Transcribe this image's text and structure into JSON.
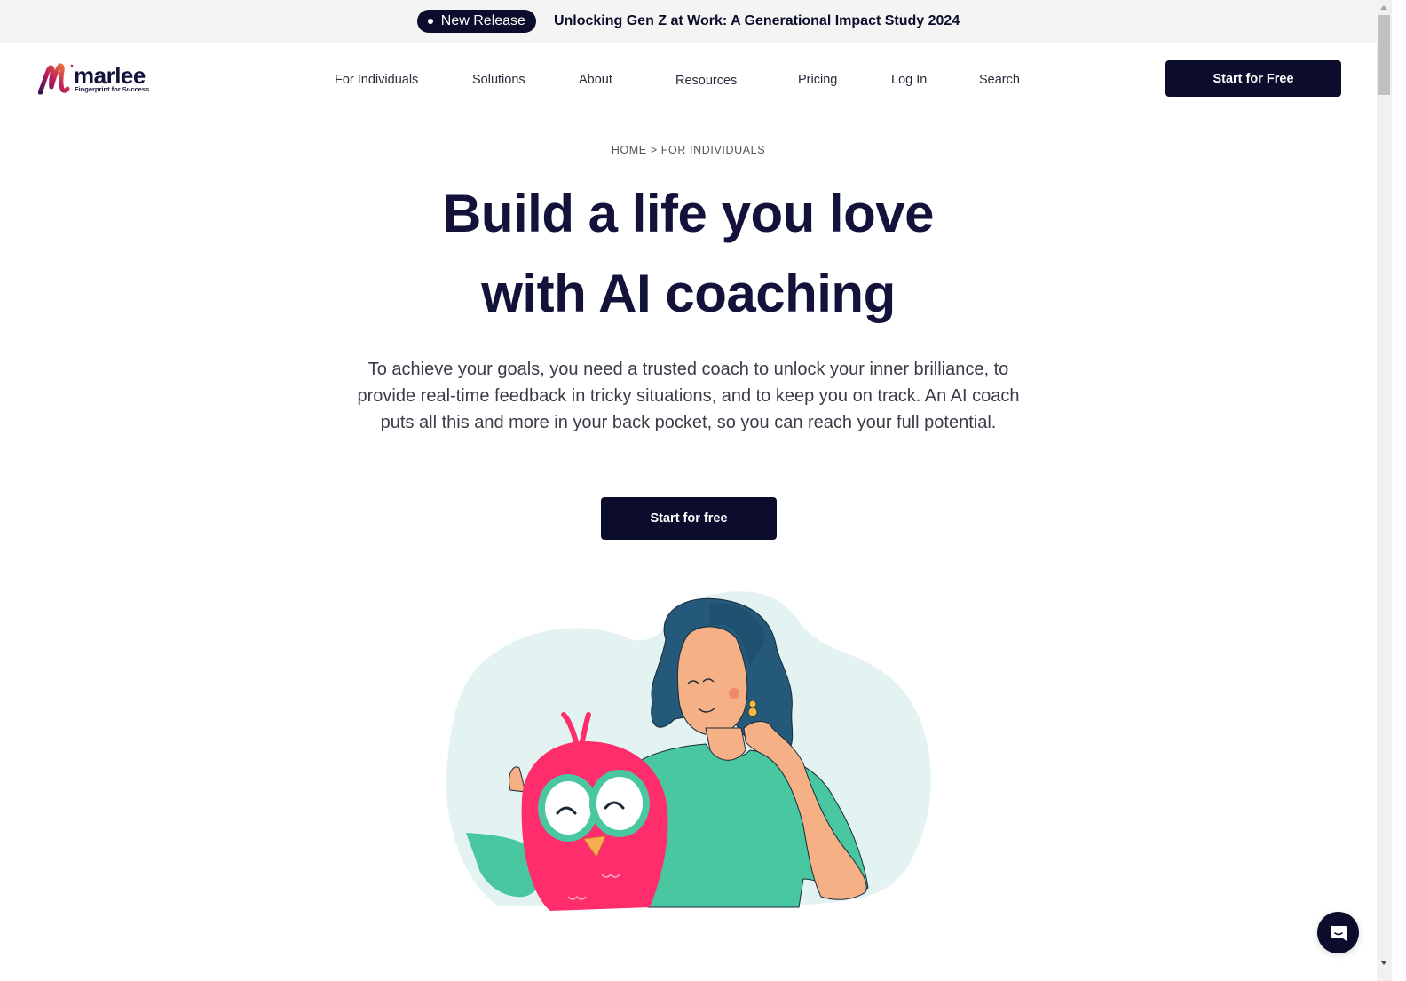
{
  "announcement": {
    "badge": "New Release",
    "link_text": "Unlocking Gen Z at Work: A Generational Impact Study 2024"
  },
  "brand": {
    "name": "marlee",
    "tagline": "Fingerprint for Success",
    "primary_color": "#0c0c2c"
  },
  "nav": {
    "items": [
      {
        "label": "For Individuals"
      },
      {
        "label": "Solutions"
      },
      {
        "label": "About"
      },
      {
        "label": "Resources"
      },
      {
        "label": "Pricing"
      },
      {
        "label": "Log In"
      },
      {
        "label": "Search"
      }
    ],
    "cta_label": "Start for Free"
  },
  "breadcrumb": {
    "text": "HOME > FOR INDIVIDUALS"
  },
  "hero": {
    "title_line1": "Build a life you love",
    "title_line2": "with AI coaching",
    "subtitle": "To achieve your goals, you need a trusted coach to unlock your inner brilliance, to provide real-time feedback in tricky situations, and to keep you on track. An AI coach puts all this and more in your back pocket, so you can reach your full potential.",
    "cta_label": "Start for free"
  },
  "illustration": {
    "description": "Woman with teal hair smiling, hugging a pink owl mascot"
  },
  "chat": {
    "icon": "chat-icon"
  }
}
